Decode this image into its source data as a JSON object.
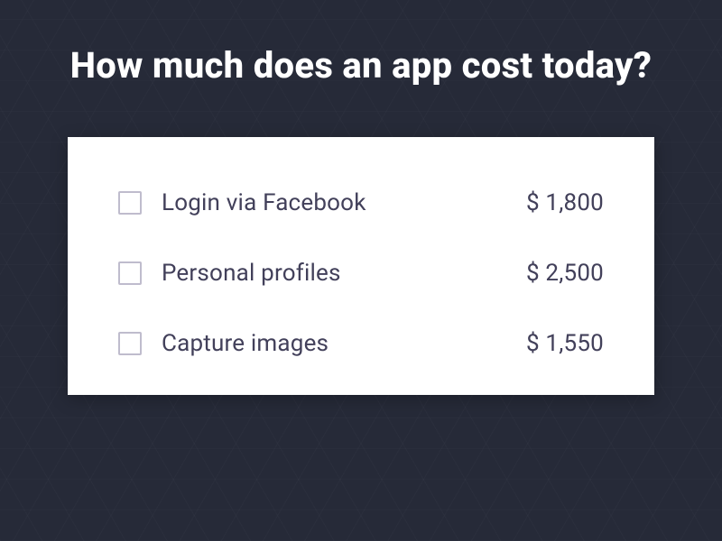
{
  "header": {
    "title": "How much does an app cost today?"
  },
  "options": [
    {
      "label": "Login via Facebook",
      "price": "$ 1,800"
    },
    {
      "label": "Personal profiles",
      "price": "$ 2,500"
    },
    {
      "label": "Capture images",
      "price": "$ 1,550"
    }
  ]
}
